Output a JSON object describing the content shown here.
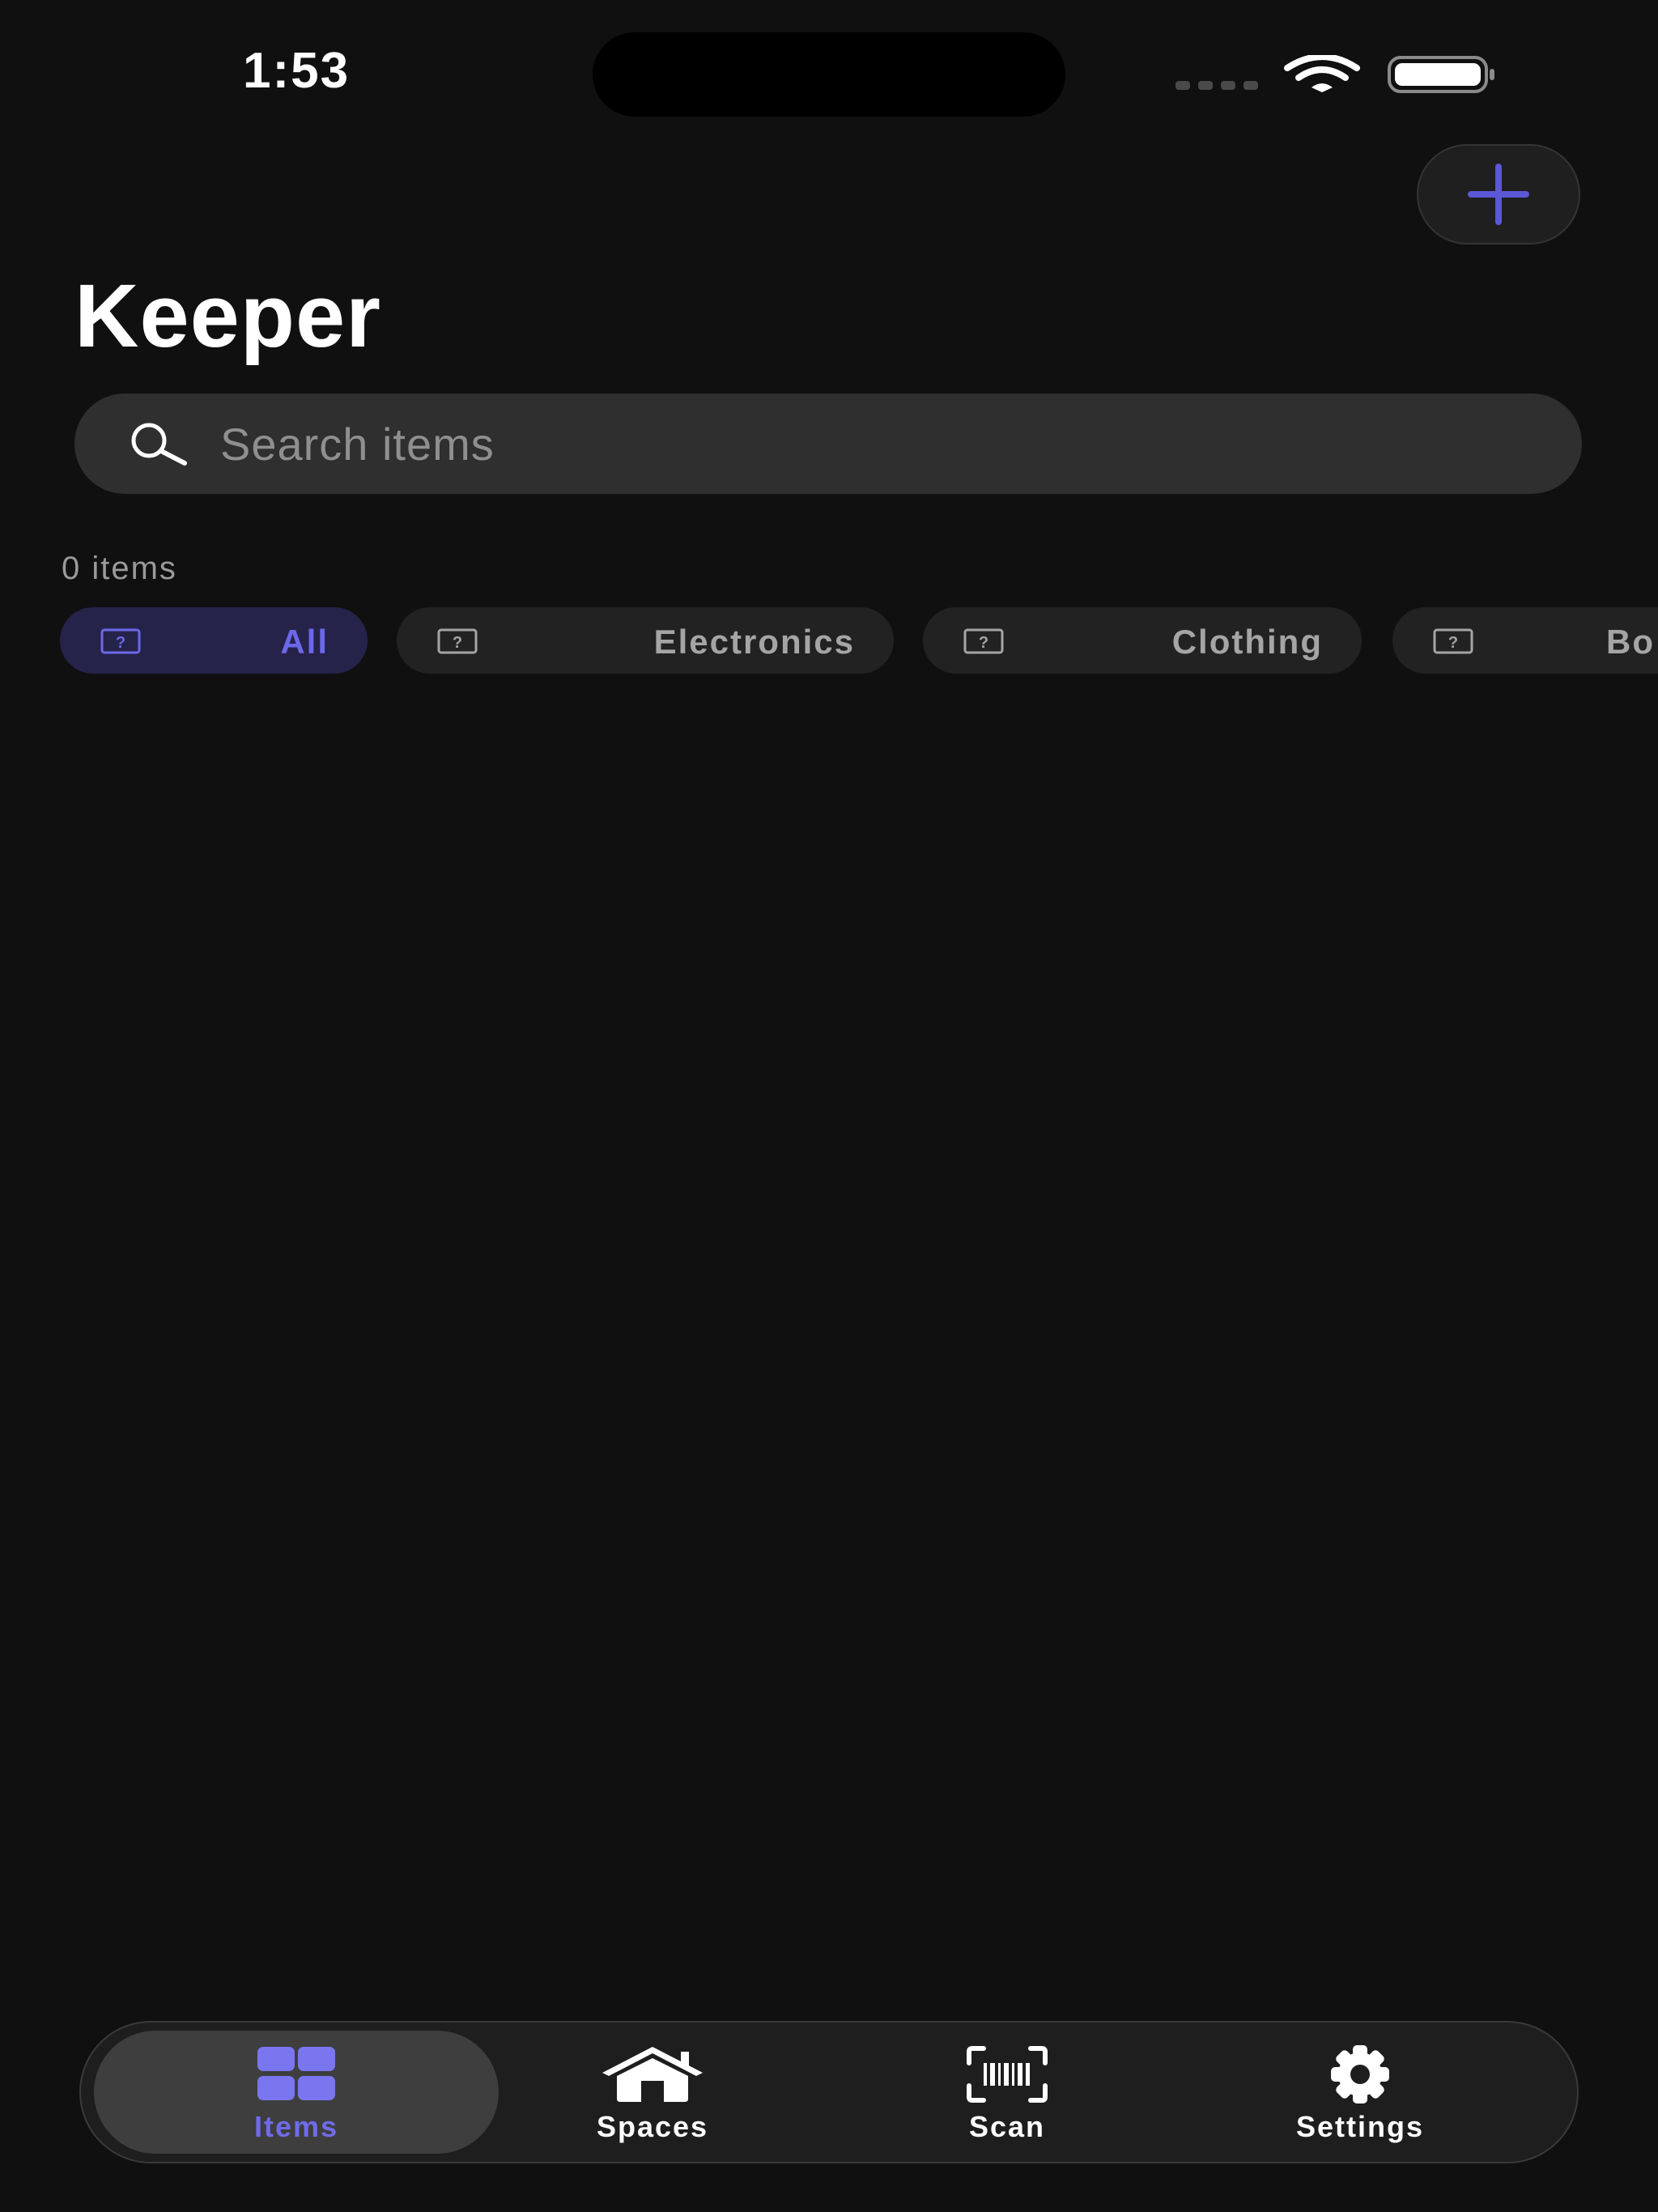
{
  "status_bar": {
    "time": "1:53"
  },
  "header": {
    "title": "Keeper",
    "add_icon": "plus-icon"
  },
  "search": {
    "placeholder": "Search items",
    "value": "",
    "icon": "search-icon"
  },
  "list": {
    "count_label": "0 items"
  },
  "filters": {
    "selected": "All",
    "items": [
      {
        "label": "All",
        "icon": "category-placeholder-icon"
      },
      {
        "label": "Electronics",
        "icon": "category-placeholder-icon"
      },
      {
        "label": "Clothing",
        "icon": "category-placeholder-icon"
      },
      {
        "label": "Bo",
        "icon": "category-placeholder-icon"
      }
    ]
  },
  "tab_bar": {
    "selected": "Items",
    "tabs": [
      {
        "label": "Items",
        "icon": "grid-icon"
      },
      {
        "label": "Spaces",
        "icon": "house-icon"
      },
      {
        "label": "Scan",
        "icon": "barcode-scan-icon"
      },
      {
        "label": "Settings",
        "icon": "gear-icon"
      }
    ]
  },
  "colors": {
    "background": "#101010",
    "accent": "#6c68e8",
    "surface": "#2f2f2f",
    "chip_selected_bg": "#25234a"
  }
}
